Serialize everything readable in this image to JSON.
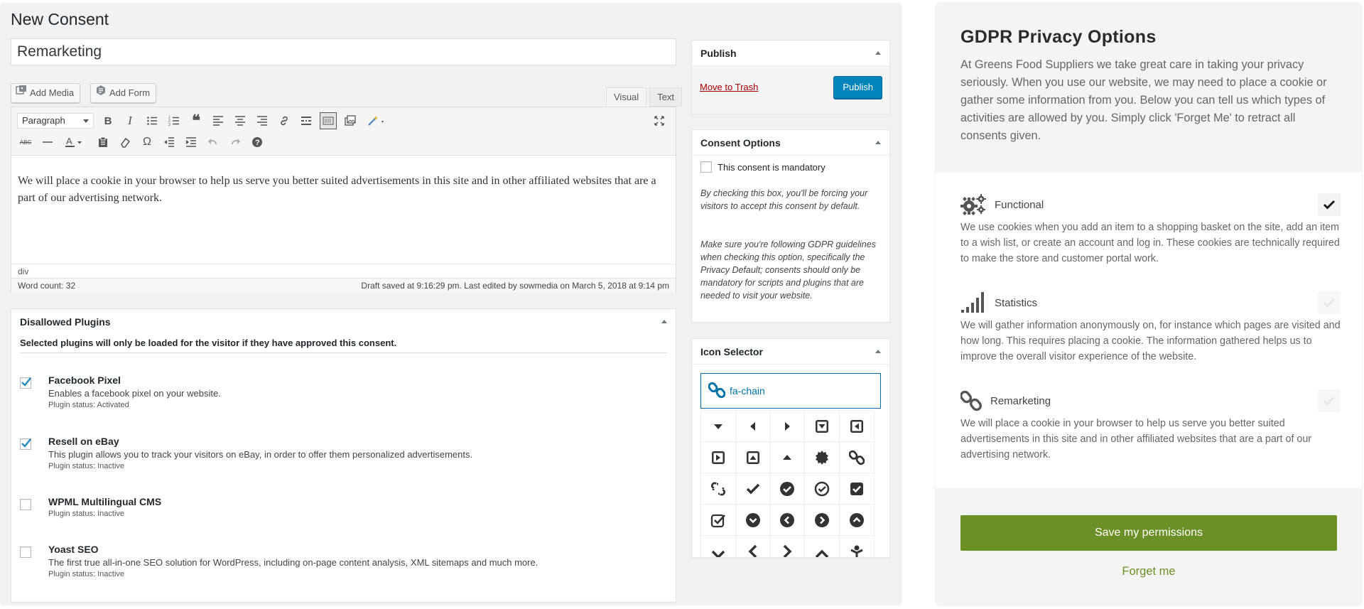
{
  "admin": {
    "page_title": "New Consent",
    "post_title": "Remarketing",
    "add_media_label": "Add Media",
    "add_form_label": "Add Form",
    "tab_visual": "Visual",
    "tab_text": "Text",
    "format_select": "Paragraph",
    "editor_content": "We will place a cookie in your browser to help us serve you better suited advertisements in this site and in other affiliated websites that are a part of our advertising network.",
    "path": "div",
    "word_count": "Word count: 32",
    "draft_status": "Draft saved at 9:16:29 pm. Last edited by sowmedia on March 5, 2018 at 9:14 pm"
  },
  "disallowed": {
    "title": "Disallowed Plugins",
    "description": "Selected plugins will only be loaded for the visitor if they have approved this consent.",
    "plugins": [
      {
        "name": "Facebook Pixel",
        "description": "Enables a facebook pixel on your website.",
        "status": "Plugin status: Activated",
        "checked": true
      },
      {
        "name": "Resell on eBay",
        "description": "This plugin allows you to track your visitors on eBay, in order to offer them personalized advertisements.",
        "status": "Plugin status: Inactive",
        "checked": true
      },
      {
        "name": "WPML Multilingual CMS",
        "description": "",
        "status": "Plugin status: Inactive",
        "checked": false
      },
      {
        "name": "Yoast SEO",
        "description": "The first true all-in-one SEO solution for WordPress, including on-page content analysis, XML sitemaps and much more.",
        "status": "Plugin status: Inactive",
        "checked": false
      }
    ]
  },
  "publish": {
    "title": "Publish",
    "trash_label": "Move to Trash",
    "publish_label": "Publish"
  },
  "consent_options": {
    "title": "Consent Options",
    "mandatory_label": "This consent is mandatory",
    "note1": "By checking this box, you'll be forcing your visitors to accept this consent by default.",
    "note2": "Make sure you're following GDPR guidelines when checking this option, specifically the Privacy Default; consents should only be mandatory for scripts and plugins that are needed to visit your website."
  },
  "icon_selector": {
    "title": "Icon Selector",
    "selected": "fa-chain"
  },
  "gdpr": {
    "title": "GDPR Privacy Options",
    "intro": "At Greens Food Suppliers we take great care in taking your privacy seriously. When you use our website, we may need to place a cookie or gather some information from you. Below you can tell us which types of activities are allowed by you. Simply click 'Forget Me' to retract all consents given.",
    "sections": [
      {
        "name": "Functional",
        "icon": "gears-icon",
        "description": "We use cookies when you add an item to a shopping basket on the site, add an item to a wish list, or create an account and log in. These cookies are technically required to make the store and customer portal work.",
        "checked": true
      },
      {
        "name": "Statistics",
        "icon": "signal-icon",
        "description": "We will gather information anonymously on, for instance which pages are visited and how long. This requires placing a cookie. The information gathered helps us to improve the overall visitor experience of the website.",
        "checked": false
      },
      {
        "name": "Remarketing",
        "icon": "chain-icon",
        "description": "We will place a cookie in your browser to help us serve you better suited advertisements in this site and in other affiliated websites that are a part of our advertising network.",
        "checked": false
      }
    ],
    "save_label": "Save my permissions",
    "forget_label": "Forget me"
  },
  "colors": {
    "wp_blue": "#0085ba",
    "trash_red": "#aa0000",
    "gdpr_green": "#6b9126",
    "link_blue": "#0073aa"
  }
}
